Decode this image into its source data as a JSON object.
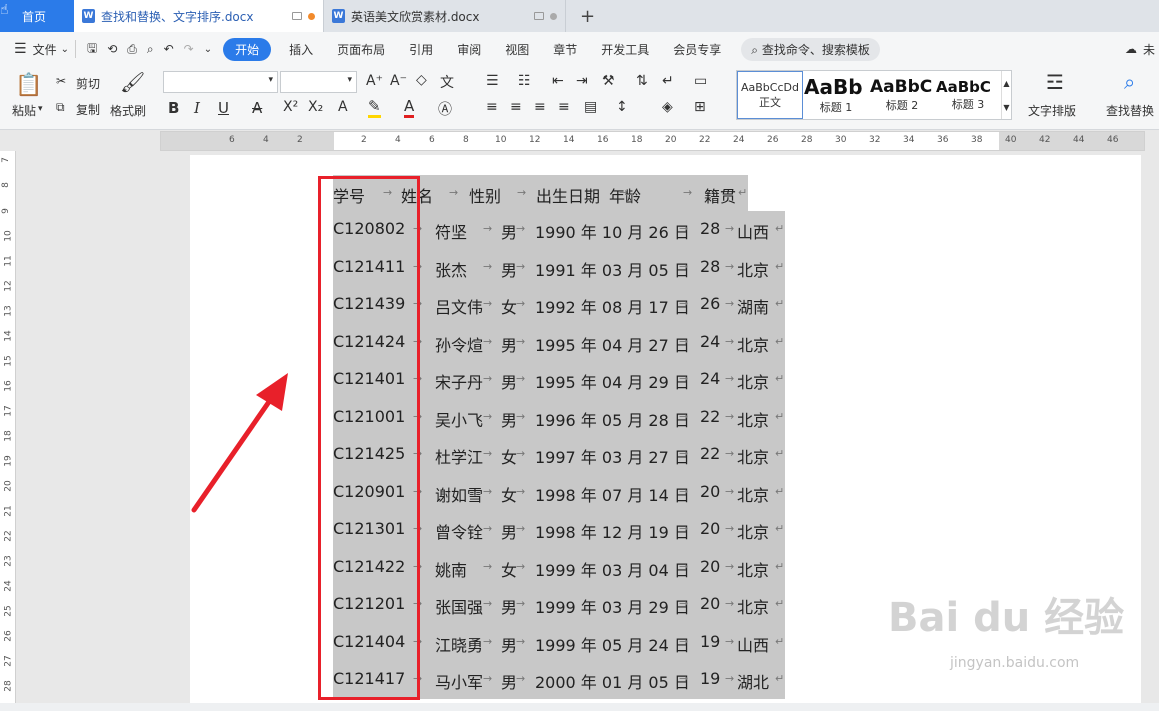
{
  "tabs": {
    "home": "首页",
    "doc1": "查找和替换、文字排序.docx",
    "doc2": "英语美文欣赏素材.docx"
  },
  "menu": {
    "file": "文件",
    "items": [
      "开始",
      "插入",
      "页面布局",
      "引用",
      "审阅",
      "视图",
      "章节",
      "开发工具",
      "会员专享"
    ],
    "search": "查找命令、搜索模板",
    "right": "未"
  },
  "toolbar": {
    "paste": "粘贴",
    "cut": "剪切",
    "copy": "复制",
    "format_painter": "格式刷",
    "styles": [
      {
        "preview": "AaBbCcDd",
        "name": "正文"
      },
      {
        "preview": "AaBb",
        "name": "标题 1"
      },
      {
        "preview": "AaBbC",
        "name": "标题 2"
      },
      {
        "preview": "AaBbC",
        "name": "标题 3"
      }
    ],
    "text_layout": "文字排版",
    "find_replace": "查找替换"
  },
  "ruler": {
    "h_ticks": [
      "6",
      "4",
      "2",
      "2",
      "4",
      "6",
      "8",
      "10",
      "12",
      "14",
      "16",
      "18",
      "20",
      "22",
      "24",
      "26",
      "28",
      "30",
      "32",
      "34",
      "36",
      "38",
      "40",
      "42",
      "44",
      "46"
    ],
    "v_ticks": [
      "7",
      "8",
      "9",
      "10",
      "11",
      "12",
      "13",
      "14",
      "15",
      "16",
      "17",
      "18",
      "19",
      "20",
      "21",
      "22",
      "23",
      "24",
      "25",
      "26",
      "27",
      "28"
    ]
  },
  "document": {
    "header": [
      "学号",
      "姓名",
      "性别",
      "出生日期",
      "年龄",
      "籍贯"
    ],
    "rows": [
      [
        "C120802",
        "符坚",
        "男",
        "1990 年 10 月 26 日",
        "28",
        "山西"
      ],
      [
        "C121411",
        "张杰",
        "男",
        "1991 年 03 月 05 日",
        "28",
        "北京"
      ],
      [
        "C121439",
        "吕文伟",
        "女",
        "1992 年 08 月 17 日",
        "26",
        "湖南"
      ],
      [
        "C121424",
        "孙令煊",
        "男",
        "1995 年 04 月 27 日",
        "24",
        "北京"
      ],
      [
        "C121401",
        "宋子丹",
        "男",
        "1995 年 04 月 29 日",
        "24",
        "北京"
      ],
      [
        "C121001",
        "吴小飞",
        "男",
        "1996 年 05 月 28 日",
        "22",
        "北京"
      ],
      [
        "C121425",
        "杜学江",
        "女",
        "1997 年 03 月 27 日",
        "22",
        "北京"
      ],
      [
        "C120901",
        "谢如雪",
        "女",
        "1998 年 07 月 14 日",
        "20",
        "北京"
      ],
      [
        "C121301",
        "曾令铨",
        "男",
        "1998 年 12 月 19 日",
        "20",
        "北京"
      ],
      [
        "C121422",
        "姚南",
        "女",
        "1999 年 03 月 04 日",
        "20",
        "北京"
      ],
      [
        "C121201",
        "张国强",
        "男",
        "1999 年 03 月 29 日",
        "20",
        "北京"
      ],
      [
        "C121404",
        "江晓勇",
        "男",
        "1999 年 05 月 24 日",
        "19",
        "山西"
      ],
      [
        "C121417",
        "马小军",
        "男",
        "2000 年 01 月 05 日",
        "19",
        "湖北"
      ]
    ]
  },
  "watermark": {
    "main": "Bai du 经验",
    "sub": "jingyan.baidu.com"
  },
  "colors": {
    "accent": "#2b7be9",
    "annotation": "#e8202a",
    "selection": "#c8c8c8"
  }
}
